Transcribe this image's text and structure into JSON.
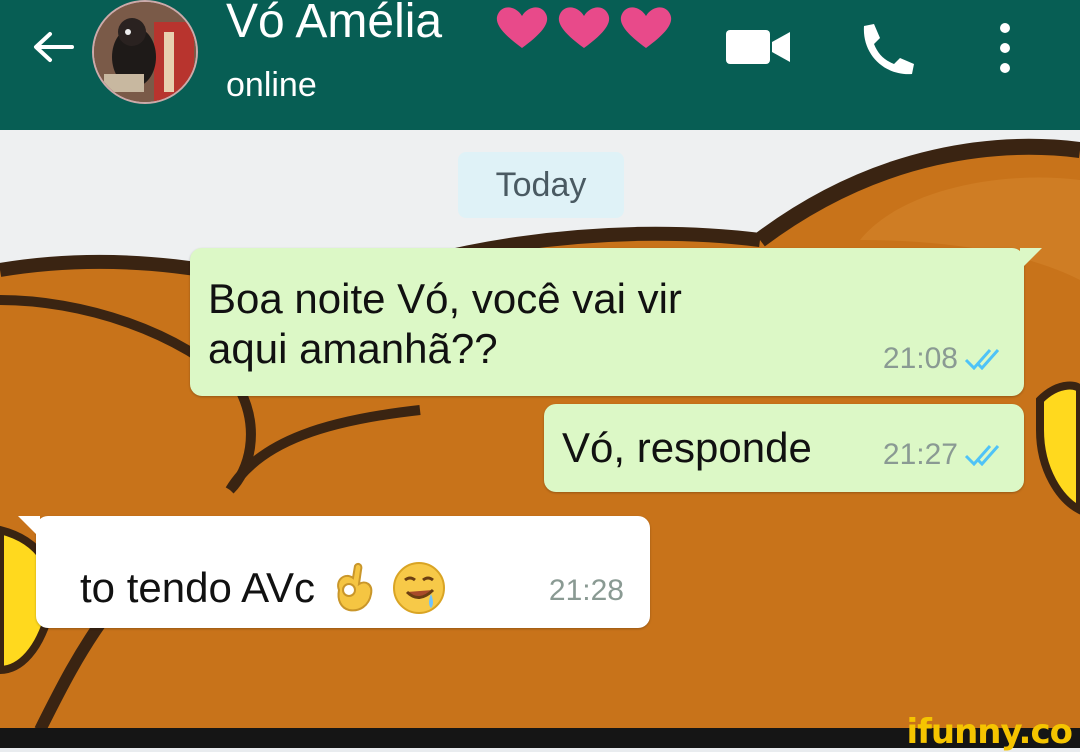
{
  "header": {
    "contact_name": "Vó Amélia",
    "status": "online",
    "hearts_count": 3
  },
  "chat": {
    "date_label": "Today",
    "messages": [
      {
        "direction": "out",
        "text_line1": "Boa noite Vó, você vai vir",
        "text_line2": "aqui amanhã??",
        "time": "21:08",
        "ticks": "read"
      },
      {
        "direction": "out",
        "text": "Vó, responde",
        "time": "21:27",
        "ticks": "read"
      },
      {
        "direction": "in",
        "text": "to tendo AVc",
        "emojis": [
          "ok-hand-icon",
          "drooling-face-icon"
        ],
        "time": "21:28"
      }
    ]
  },
  "watermark": "ifunny.co",
  "colors": {
    "header": "#075e54",
    "outgoing_bubble": "#dcf8c6",
    "incoming_bubble": "#ffffff",
    "tick_read": "#4fc3f7",
    "heart": "#e84a8a",
    "bear_brown": "#c8731a",
    "bear_dark": "#3a2412",
    "bear_yellow": "#ffd91e"
  }
}
